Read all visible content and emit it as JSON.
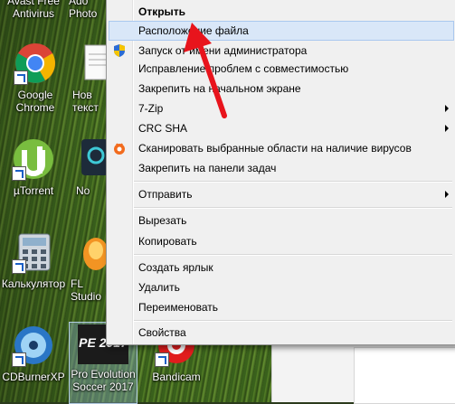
{
  "desktop": {
    "icons": [
      {
        "label": "Avast Free Antivirus",
        "icon": "avast-icon"
      },
      {
        "label": "Ado Photo",
        "icon": "photoshop-icon"
      },
      {
        "label": "Google Chrome",
        "icon": "chrome-icon"
      },
      {
        "label": "Нов текст",
        "icon": "text-document-icon"
      },
      {
        "label": "µTorrent",
        "icon": "utorrent-icon"
      },
      {
        "label": "No",
        "icon": "app-icon"
      },
      {
        "label": "Калькулятор",
        "icon": "calculator-icon"
      },
      {
        "label": "FL Studio",
        "icon": "fl-studio-icon"
      },
      {
        "label": "CDBurnerXP",
        "icon": "cdburnerxp-icon"
      },
      {
        "label": "Pro Evolution Soccer 2017",
        "icon": "pes2017-icon",
        "badge": "PE 2017"
      },
      {
        "label": "Bandicam",
        "icon": "bandicam-icon"
      }
    ]
  },
  "context_menu": {
    "items": [
      {
        "label": "Открыть",
        "bold": true
      },
      {
        "label": "Расположение файла",
        "highlighted": true
      },
      {
        "label": "Запуск от имени администратора",
        "icon": "uac-shield-icon"
      },
      {
        "label": "Исправление проблем с совместимостью"
      },
      {
        "label": "Закрепить на начальном экране"
      },
      {
        "label": "7-Zip",
        "submenu": true
      },
      {
        "label": "CRC SHA",
        "submenu": true
      },
      {
        "label": "Сканировать выбранные области на наличие вирусов",
        "icon": "avast-icon"
      },
      {
        "label": "Закрепить на панели задач"
      },
      {
        "label": "Отправить",
        "submenu": true
      },
      {
        "label": "Вырезать"
      },
      {
        "label": "Копировать"
      },
      {
        "label": "Создать ярлык"
      },
      {
        "label": "Удалить"
      },
      {
        "label": "Переименовать"
      },
      {
        "label": "Свойства"
      }
    ]
  },
  "colors": {
    "menu_bg": "#f0f0f0",
    "highlight": "#d9e7f8",
    "annotation_arrow": "#e8141c"
  }
}
